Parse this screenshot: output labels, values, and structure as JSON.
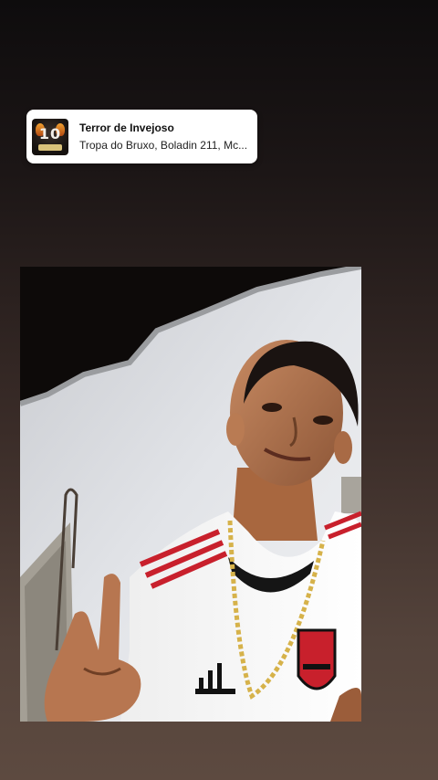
{
  "music_sticker": {
    "title": "Terror de Invejoso",
    "artists": "Tropa do Bruxo, Boladin 211, Mc...",
    "album_art_icon": "album-cover-art"
  },
  "photo": {
    "description_icon": "selfie-photo"
  },
  "colors": {
    "background_top": "#0e0c0d",
    "background_bottom": "#5d4a40",
    "sticker_bg": "#ffffff",
    "jersey_red": "#c8202c"
  }
}
